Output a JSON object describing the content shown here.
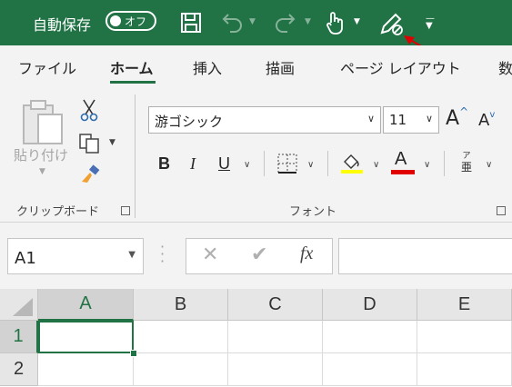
{
  "titlebar": {
    "autosave_label": "自動保存",
    "autosave_state": "オフ",
    "background": "#217346"
  },
  "tabs": [
    {
      "label": "ファイル",
      "active": false
    },
    {
      "label": "ホーム",
      "active": true
    },
    {
      "label": "挿入",
      "active": false
    },
    {
      "label": "描画",
      "active": false
    },
    {
      "label": "ページ レイアウト",
      "active": false
    },
    {
      "label": "数",
      "active": false
    }
  ],
  "ribbon": {
    "clipboard": {
      "paste_label": "貼り付け",
      "group_label": "クリップボード"
    },
    "font": {
      "font_name": "游ゴシック",
      "font_size": "11",
      "bold": "B",
      "italic": "I",
      "underline": "U",
      "font_color_letter": "A",
      "grow_letter": "A",
      "shrink_letter": "A",
      "phonetic_top": "ア",
      "phonetic_bottom": "亜",
      "group_label": "フォント",
      "highlight_color": "#ffff00",
      "font_color": "#e00000"
    }
  },
  "formula_bar": {
    "name_box": "A1",
    "fx_label": "fx",
    "value": ""
  },
  "sheet": {
    "columns": [
      "A",
      "B",
      "C",
      "D",
      "E"
    ],
    "rows": [
      "1",
      "2"
    ],
    "active_cell": "A1",
    "accent": "#217346"
  }
}
